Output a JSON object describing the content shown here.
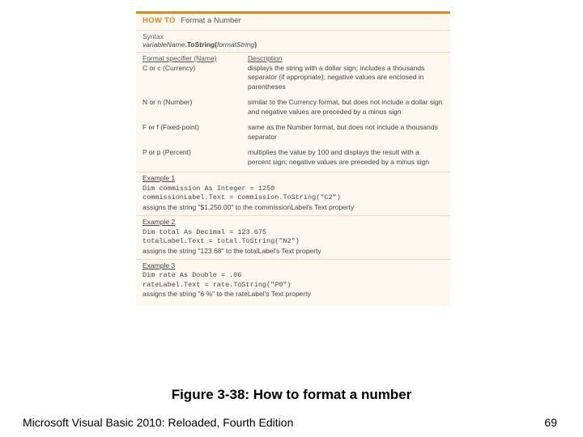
{
  "panel": {
    "howto_label": "HOW TO",
    "howto_title": "Format a Number",
    "syntax_label": "Syntax",
    "syntax_prefix": "variableName",
    "syntax_bold": ".ToString(",
    "syntax_mid": "formatString",
    "syntax_close": ")",
    "table": {
      "col1_header": "Format specifier (Name)",
      "col2_header": "Description",
      "rows": [
        {
          "spec": "C or c (Currency)",
          "desc": "displays the string with a dollar sign; includes a thousands separator (if appropriate); negative values are enclosed in parentheses"
        },
        {
          "spec": "N or n (Number)",
          "desc": "similar to the Currency format, but does not include a dollar sign and negative values are preceded by a minus sign"
        },
        {
          "spec": "F or f (Fixed-point)",
          "desc": "same as the Number format, but does not include a thousands separator"
        },
        {
          "spec": "P or p (Percent)",
          "desc": "multiplies the value by 100 and displays the result with a percent sign; negative values are preceded by a minus sign"
        }
      ]
    },
    "examples": [
      {
        "label": "Example 1",
        "code1": "Dim commission As Integer = 1250",
        "code2": "commissionLabel.Text = commission.ToString(\"C2\")",
        "explain": "assigns the string \"$1,250.00\" to the commissionLabel's Text property"
      },
      {
        "label": "Example 2",
        "code1": "Dim total As Decimal = 123.675",
        "code2": "totalLabel.Text = total.ToString(\"N2\")",
        "explain": "assigns the string \"123.68\" to the totalLabel's Text property"
      },
      {
        "label": "Example 3",
        "code1": "Dim rate As Double = .06",
        "code2": "rateLabel.Text = rate.ToString(\"P0\")",
        "explain": "assigns the string \"6 %\" to the rateLabel's Text property"
      }
    ]
  },
  "caption": "Figure 3-38: How to format a number",
  "footer": {
    "left": "Microsoft Visual Basic 2010: Reloaded, Fourth Edition",
    "right": "69"
  }
}
